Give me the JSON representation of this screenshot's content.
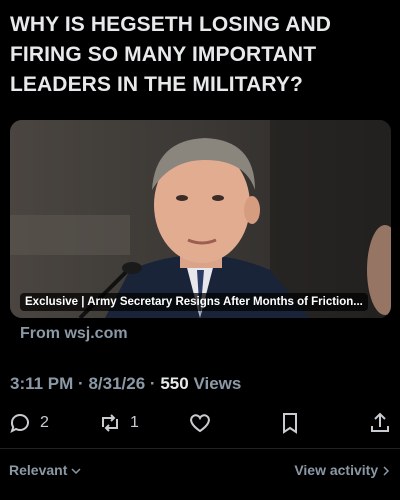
{
  "post": {
    "text": "WHY IS HEGSETH LOSING AND FIRING SO MANY IMPORTANT LEADERS IN THE MILITARY?"
  },
  "link_card": {
    "caption": "Exclusive | Army Secretary Resigns After Months of Friction...",
    "source": "From wsj.com"
  },
  "meta": {
    "time": "3:11 PM",
    "date": "8/31/26",
    "separator": "·",
    "views_count": "550",
    "views_label": "Views"
  },
  "actions": {
    "replies": "2",
    "reposts": "1"
  },
  "footer": {
    "sort_label": "Relevant",
    "view_activity": "View activity"
  },
  "colors": {
    "background": "#000000",
    "primary_text": "#e7e9ea",
    "secondary_text": "#8b98a5"
  }
}
